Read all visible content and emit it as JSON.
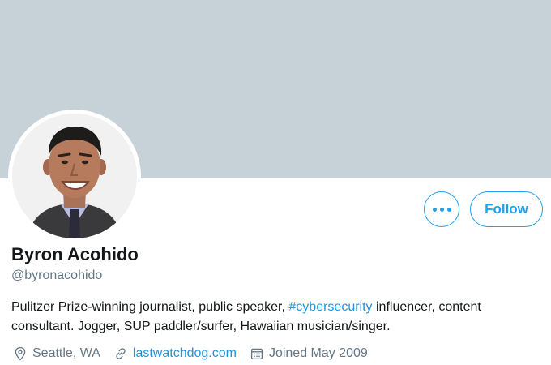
{
  "profile": {
    "name": "Byron Acohido",
    "handle": "@byronacohido",
    "bio": {
      "before": "Pulitzer Prize-winning journalist, public speaker, ",
      "hashtag": "#cybersecurity",
      "after": " influencer, content consultant. Jogger, SUP paddler/surfer, Hawaiian musician/singer."
    },
    "location": "Seattle, WA",
    "website": "lastwatchdog.com",
    "joined": "Joined May 2009"
  },
  "actions": {
    "follow_label": "Follow",
    "more_icon": "more-dots-icon"
  },
  "colors": {
    "banner": "#c6d1d8",
    "accent": "#1da1f2",
    "link": "#1b95e0",
    "secondary_text": "#657786"
  }
}
